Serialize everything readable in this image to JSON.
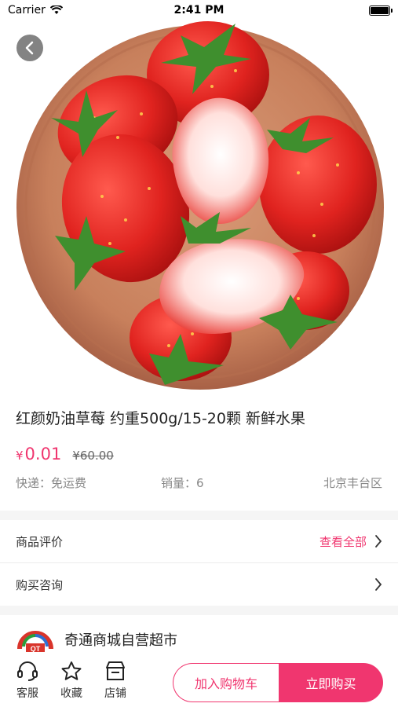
{
  "status": {
    "carrier": "Carrier",
    "time": "2:41 PM"
  },
  "product": {
    "image": "strawberries-in-wooden-bowl",
    "title": "红颜奶油草莓 约重500g/15-20颗 新鲜水果",
    "currency": "¥",
    "price": "0.01",
    "original_price": "¥60.00",
    "shipping": "快递：免运费",
    "sales": "销量：6",
    "location": "北京丰台区"
  },
  "reviews": {
    "label": "商品评价",
    "more": "查看全部"
  },
  "consult": {
    "label": "购买咨询"
  },
  "shop": {
    "name": "奇通商城自营超市",
    "logo_text": "QT"
  },
  "bottom_bar": {
    "service": "客服",
    "favorite": "收藏",
    "store": "店铺",
    "add_cart": "加入购物车",
    "buy_now": "立即购买"
  },
  "colors": {
    "accent": "#f0366f"
  }
}
